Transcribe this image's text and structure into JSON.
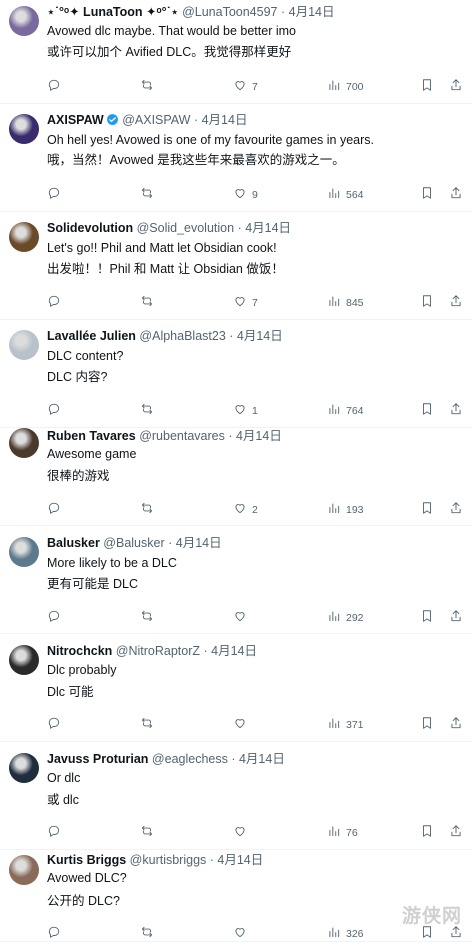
{
  "tweets": [
    {
      "name": "⋆˙°ᵒ✦ LunaToon ✦ᵒ°˙⋆",
      "handle": "@LunaToon4597",
      "date": "4月14日",
      "line1": "Avowed dlc maybe. That would be better imo",
      "line2": "或许可以加个 Avified DLC。我觉得那样更好",
      "replies": "",
      "retweets": "",
      "likes": "7",
      "views": "700",
      "verified": false,
      "avatar_color": "#7b6a9e"
    },
    {
      "name": "AXISPAW",
      "handle": "@AXISPAW",
      "date": "4月14日",
      "line1": "Oh hell yes! Avowed is one of my favourite games in years.",
      "line2": "哦，当然！Avowed 是我这些年来最喜欢的游戏之一。",
      "replies": "",
      "retweets": "",
      "likes": "9",
      "views": "564",
      "verified": true,
      "avatar_color": "#3a2b6e"
    },
    {
      "name": "Solidevolution",
      "handle": "@Solid_evolution",
      "date": "4月14日",
      "line1": "Let's go!! Phil and Matt let Obsidian cook!",
      "line2": "出发啦！！Phil 和 Matt 让 Obsidian 做饭！",
      "replies": "",
      "retweets": "",
      "likes": "7",
      "views": "845",
      "verified": false,
      "avatar_color": "#6b4a2a"
    },
    {
      "name": "Lavallée Julien",
      "handle": "@AlphaBlast23",
      "date": "4月14日",
      "line1": "DLC content?",
      "line2": "DLC 内容?",
      "replies": "",
      "retweets": "",
      "likes": "1",
      "views": "764",
      "verified": false,
      "avatar_color": "#b8c2cc"
    },
    {
      "name": "Ruben Tavares",
      "handle": "@rubentavares",
      "date": "4月14日",
      "line1": "Awesome game",
      "line2": "很棒的游戏",
      "replies": "",
      "retweets": "",
      "likes": "2",
      "views": "193",
      "verified": false,
      "avatar_color": "#4a3a2e"
    },
    {
      "name": "Balusker",
      "handle": "@Balusker",
      "date": "4月14日",
      "line1": "More likely to be a DLC",
      "line2": "更有可能是 DLC",
      "replies": "",
      "retweets": "",
      "likes": "",
      "views": "292",
      "verified": false,
      "avatar_color": "#5d7a8c"
    },
    {
      "name": "Nitrochckn",
      "handle": "@NitroRaptorZ",
      "date": "4月14日",
      "line1": "Dlc probably",
      "line2": "Dlc 可能",
      "replies": "",
      "retweets": "",
      "likes": "",
      "views": "371",
      "verified": false,
      "avatar_color": "#2a2a2a"
    },
    {
      "name": "Javuss Proturian",
      "handle": "@eaglechess",
      "date": "4月14日",
      "line1": "Or dlc",
      "line2": "或 dlc",
      "replies": "",
      "retweets": "",
      "likes": "",
      "views": "76",
      "verified": false,
      "avatar_color": "#1f2d3d"
    },
    {
      "name": "Kurtis Briggs",
      "handle": "@kurtisbriggs",
      "date": "4月14日",
      "line1": "Avowed DLC?",
      "line2": "公开的 DLC?",
      "replies": "",
      "retweets": "",
      "likes": "",
      "views": "326",
      "verified": false,
      "avatar_color": "#8a6a58"
    }
  ],
  "icons": {
    "reply": "reply-icon",
    "retweet": "retweet-icon",
    "like": "heart-icon",
    "views": "views-icon",
    "bookmark": "bookmark-icon",
    "share": "share-icon"
  },
  "watermark": "游侠网",
  "colors": {
    "text": "#0f1419",
    "muted": "#536471",
    "verified": "#1d9bf0"
  }
}
